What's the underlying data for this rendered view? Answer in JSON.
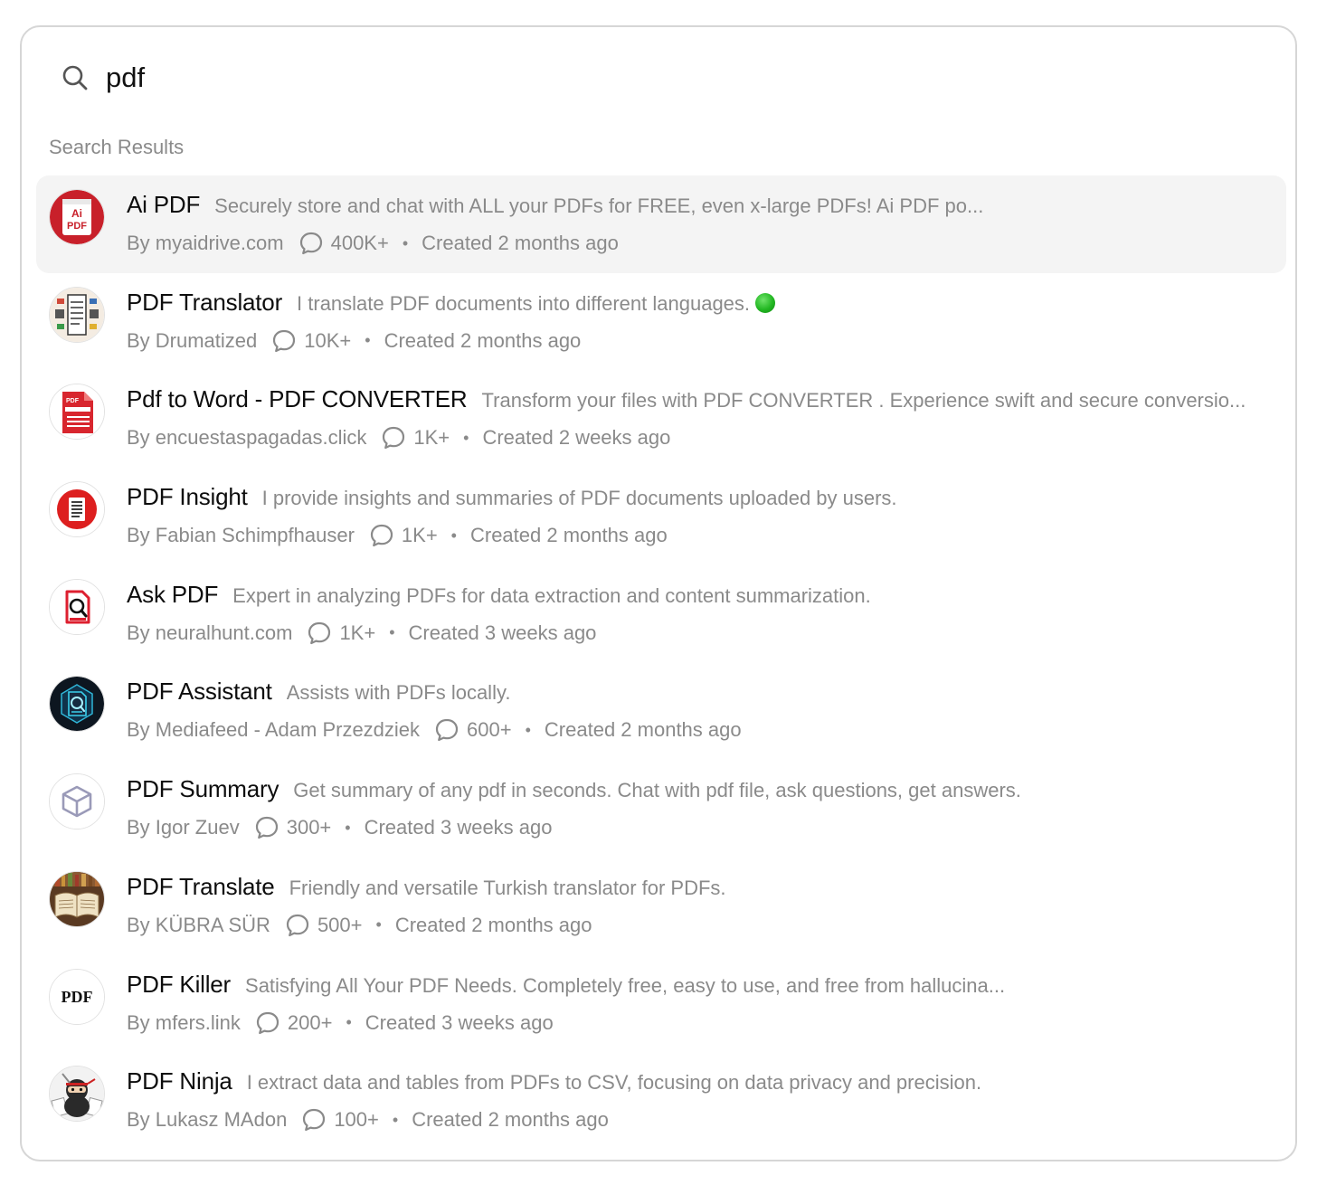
{
  "search": {
    "value": "pdf",
    "icon": "search-icon"
  },
  "section_label": "Search Results",
  "colors": {
    "selected_bg": "#f4f4f4",
    "muted_text": "#8a8a8a",
    "title_text": "#0d0d0d",
    "border": "#d6d6d6"
  },
  "results": [
    {
      "name": "Ai PDF",
      "description": "Securely store and chat with ALL your PDFs for FREE, even x-large PDFs! Ai PDF po...",
      "author": "By myaidrive.com",
      "conversations": "400K+",
      "separator": "•",
      "created": "Created 2 months ago",
      "selected": true,
      "icon": "ai-pdf-logo"
    },
    {
      "name": "PDF Translator",
      "description": "I translate PDF documents into different languages.",
      "author": "By Drumatized",
      "conversations": "10K+",
      "separator": "•",
      "created": "Created 2 months ago",
      "emoji": "green-circle",
      "icon": "pdf-translator-logo"
    },
    {
      "name": "Pdf to Word - PDF CONVERTER",
      "description": "Transform your files with PDF CONVERTER . Experience swift and secure conversio...",
      "author": "By encuestaspagadas.click",
      "conversations": "1K+",
      "separator": "•",
      "created": "Created 2 weeks ago",
      "icon": "pdf-converter-logo"
    },
    {
      "name": "PDF Insight",
      "description": "I provide insights and summaries of PDF documents uploaded by users.",
      "author": "By Fabian Schimpfhauser",
      "conversations": "1K+",
      "separator": "•",
      "created": "Created 2 months ago",
      "icon": "pdf-insight-logo"
    },
    {
      "name": "Ask PDF",
      "description": "Expert in analyzing PDFs for data extraction and content summarization.",
      "author": "By neuralhunt.com",
      "conversations": "1K+",
      "separator": "•",
      "created": "Created 3 weeks ago",
      "icon": "ask-pdf-logo"
    },
    {
      "name": "PDF Assistant",
      "description": "Assists with PDFs locally.",
      "author": "By Mediafeed - Adam Przezdziek",
      "conversations": "600+",
      "separator": "•",
      "created": "Created 2 months ago",
      "icon": "pdf-assistant-logo"
    },
    {
      "name": "PDF Summary",
      "description": "Get summary of any pdf in seconds. Chat with pdf file, ask questions, get answers.",
      "author": "By Igor Zuev",
      "conversations": "300+",
      "separator": "•",
      "created": "Created 3 weeks ago",
      "icon": "cube-icon"
    },
    {
      "name": "PDF Translate",
      "description": "Friendly and versatile Turkish translator for PDFs.",
      "author": "By KÜBRA SÜR",
      "conversations": "500+",
      "separator": "•",
      "created": "Created 2 months ago",
      "icon": "pdf-translate-logo"
    },
    {
      "name": "PDF Killer",
      "description": "Satisfying All Your PDF Needs. Completely free, easy to use, and free from hallucina...",
      "author": "By mfers.link",
      "conversations": "200+",
      "separator": "•",
      "created": "Created 3 weeks ago",
      "icon": "pdf-killer-logo",
      "logo_text": "PDF"
    },
    {
      "name": "PDF Ninja",
      "description": "I extract data and tables from PDFs to CSV, focusing on data privacy and precision.",
      "author": "By Lukasz MAdon",
      "conversations": "100+",
      "separator": "•",
      "created": "Created 2 months ago",
      "icon": "pdf-ninja-logo"
    }
  ]
}
